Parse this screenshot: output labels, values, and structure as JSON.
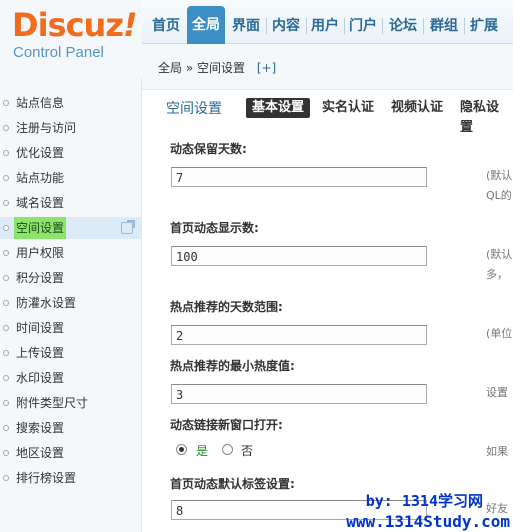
{
  "logo": {
    "brand": "Discuz",
    "bang": "!",
    "subtitle": "Control Panel"
  },
  "topnav": {
    "items": [
      "首页",
      "全局",
      "界面",
      "内容",
      "用户",
      "门户",
      "论坛",
      "群组",
      "扩展"
    ],
    "active_index": 1
  },
  "subhead": {
    "breadcrumb": "全局 » 空间设置",
    "add_label": "[+]"
  },
  "sidebar": {
    "items": [
      "站点信息",
      "注册与访问",
      "优化设置",
      "站点功能",
      "域名设置",
      "空间设置",
      "用户权限",
      "积分设置",
      "防灌水设置",
      "时间设置",
      "上传设置",
      "水印设置",
      "附件类型尺寸",
      "搜索设置",
      "地区设置",
      "排行榜设置"
    ],
    "active_index": 5
  },
  "main": {
    "page_title": "空间设置",
    "tabs": [
      "基本设置",
      "实名认证",
      "视频认证",
      "隐私设置"
    ],
    "active_tab": 0,
    "rows": [
      {
        "label": "动态保留天数:",
        "value": "7",
        "note1": "(默认",
        "note2": "QL的"
      },
      {
        "label": "首页动态显示数:",
        "value": "100",
        "note1": "(默认",
        "note2": "多，"
      },
      {
        "label": "热点推荐的天数范围:",
        "value": "2",
        "note1": "(单位"
      },
      {
        "label": "热点推荐的最小热度值:",
        "value": "3",
        "note1": "设置"
      },
      {
        "label": "动态链接新窗口打开:",
        "radio_yes": "是",
        "radio_no": "否",
        "selected": "yes",
        "note1": "如果"
      },
      {
        "label": "首页动态默认标签设置:",
        "value": "8",
        "note1": "好友"
      }
    ]
  },
  "watermark": {
    "line1": "by: 1314学习网",
    "line2": "www.1314Study.com"
  },
  "colors": {
    "accent": "#3c8ec4",
    "brand": "#f26c1f",
    "highlight": "#8ee36b",
    "watermark": "#0033cc"
  }
}
